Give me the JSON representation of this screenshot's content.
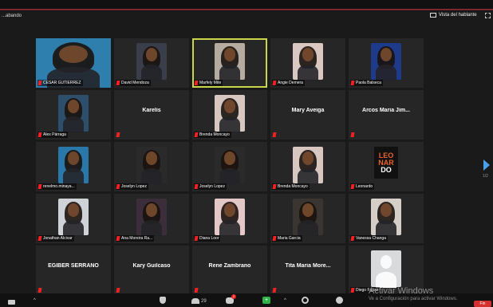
{
  "status_text": "...abando",
  "view_toggle_label": "Vista del hablante",
  "page_indicator": "1/2",
  "participants": [
    {
      "name": "CESAR GUTIERREZ",
      "video": true,
      "bg": "#2f7fae"
    },
    {
      "name": "David Mendoza",
      "video": true,
      "bg": "#3a3d4a"
    },
    {
      "name": "Marfely Mite",
      "video": true,
      "bg": "#b5ac9f",
      "active": true
    },
    {
      "name": "Angie Demera",
      "video": true,
      "bg": "#d9c7c2"
    },
    {
      "name": "Paola Balseca",
      "video": true,
      "bg": "#1e3a8a"
    },
    {
      "name": "Alex Párraga",
      "video": true,
      "bg": "#2d4f6b"
    },
    {
      "name": "Karelis",
      "video": false,
      "show_label": false
    },
    {
      "name": "Brenda Moncayo",
      "video": true,
      "bg": "#d8c6c0"
    },
    {
      "name": "Mary Aveiga",
      "video": false,
      "show_label": false
    },
    {
      "name": "Arcos Maria Jim...",
      "video": false,
      "show_label": false
    },
    {
      "name": "renelmo.minaya...",
      "video": true,
      "bg": "#2a78aa"
    },
    {
      "name": "Joselyn Lopez",
      "video": true,
      "bg": "#2a2a2a"
    },
    {
      "name": "Joselyn Lopez",
      "video": true,
      "bg": "#2a2a2a"
    },
    {
      "name": "Brenda Moncayo",
      "video": true,
      "bg": "#d8c6c0"
    },
    {
      "name": "Leonardo",
      "video": true,
      "bg": "#111111",
      "logo": [
        "LEO",
        "NAR",
        "DO"
      ]
    },
    {
      "name": "Jonathan Alcivar",
      "video": true,
      "bg": "#cfd2d6"
    },
    {
      "name": "Ana Moreira Ra...",
      "video": true,
      "bg": "#3b2e3a"
    },
    {
      "name": "Diana Loor",
      "video": true,
      "bg": "#e4c8c8"
    },
    {
      "name": "Maria Garcia",
      "video": true,
      "bg": "#3a3530"
    },
    {
      "name": "Vanessa Changa",
      "video": true,
      "bg": "#d5cfc8"
    },
    {
      "name": "EGIBER SERRANO",
      "video": false,
      "show_label": false
    },
    {
      "name": "Kary Guilcaso",
      "video": false,
      "show_label": false
    },
    {
      "name": "Rene Zambrano",
      "video": false,
      "show_label": false
    },
    {
      "name": "Tita Maria More...",
      "video": false,
      "show_label": false
    },
    {
      "name": "Diego Farias",
      "video": true,
      "bg": "#d9dadc",
      "avatar": true
    }
  ],
  "toolbar": {
    "participants_count": "29",
    "chat_badge": "2",
    "share_icon": "+"
  },
  "activation": {
    "title": "Activar Windows",
    "subtitle": "Ve a Configuración para activar Windows."
  },
  "end_label": "Fin",
  "icons": {
    "camera": "camera-icon",
    "security": "shield-icon",
    "participants": "people-icon",
    "chat": "chat-icon",
    "share": "share-screen-icon",
    "record": "record-icon",
    "reactions": "reactions-icon"
  }
}
